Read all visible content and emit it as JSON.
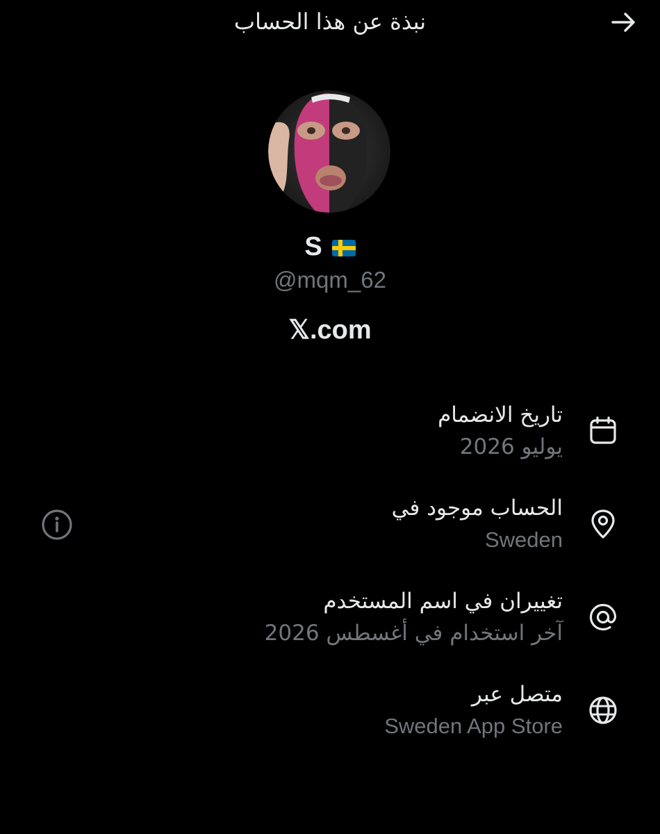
{
  "header": {
    "title": "نبذة عن هذا الحساب",
    "back_icon": "arrow-right-icon"
  },
  "profile": {
    "display_name": "S",
    "flag_icon": "sweden-flag-icon",
    "handle": "@mqm_62",
    "platform": "𝕏.com"
  },
  "rows": [
    {
      "icon": "calendar-icon",
      "title": "تاريخ الانضمام",
      "subtitle": "يوليو 2026"
    },
    {
      "icon": "location-pin-icon",
      "title": "الحساب موجود في",
      "subtitle": "Sweden"
    },
    {
      "icon": "at-sign-icon",
      "title": "تغييران في اسم المستخدم",
      "subtitle": "آخر استخدام في أغسطس 2026"
    },
    {
      "icon": "globe-icon",
      "title": "متصل عبر",
      "subtitle": "Sweden App Store"
    }
  ],
  "info_icon": "info-icon",
  "colors": {
    "background": "#000000",
    "primary_text": "#e7e9ea",
    "secondary_text": "#71767b",
    "flag_blue": "#006aa7",
    "flag_yellow": "#fecc02"
  }
}
